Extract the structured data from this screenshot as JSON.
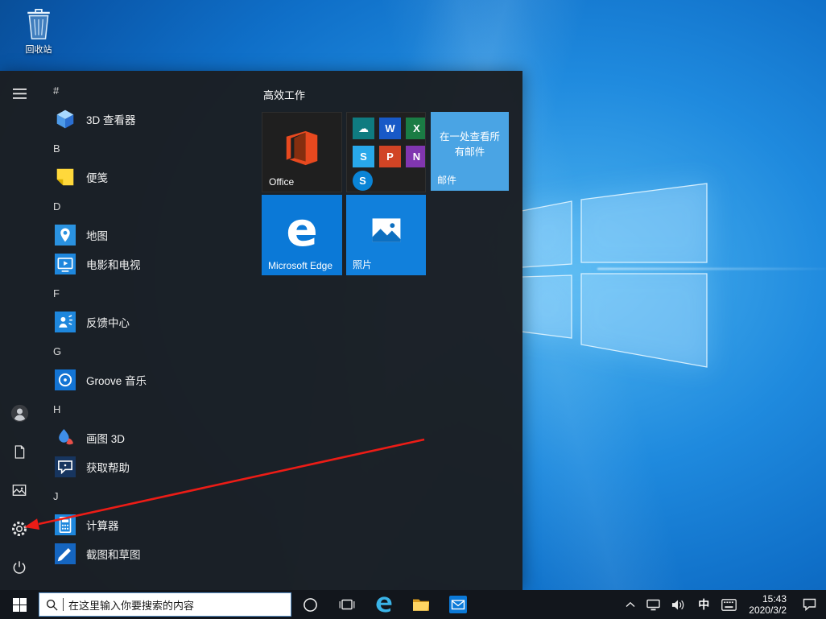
{
  "desktop": {
    "recycle_bin_label": "回收站"
  },
  "start_menu": {
    "rail": {
      "top": [
        {
          "id": "expand-menu",
          "icon": "hamburger"
        }
      ],
      "bottom": [
        {
          "id": "user-account",
          "icon": "user"
        },
        {
          "id": "documents",
          "icon": "document"
        },
        {
          "id": "pictures",
          "icon": "pictures"
        },
        {
          "id": "settings",
          "icon": "gear"
        },
        {
          "id": "power",
          "icon": "power"
        }
      ]
    },
    "app_list": [
      {
        "type": "header",
        "label": "#"
      },
      {
        "type": "app",
        "label": "3D 查看器",
        "icon": "viewer3d"
      },
      {
        "type": "header",
        "label": "B"
      },
      {
        "type": "app",
        "label": "便笺",
        "icon": "stickynotes"
      },
      {
        "type": "header",
        "label": "D"
      },
      {
        "type": "app",
        "label": "地图",
        "icon": "maps"
      },
      {
        "type": "app",
        "label": "电影和电视",
        "icon": "moviestv"
      },
      {
        "type": "header",
        "label": "F"
      },
      {
        "type": "app",
        "label": "反馈中心",
        "icon": "feedback"
      },
      {
        "type": "header",
        "label": "G"
      },
      {
        "type": "app",
        "label": "Groove 音乐",
        "icon": "groove"
      },
      {
        "type": "header",
        "label": "H"
      },
      {
        "type": "app",
        "label": "画图 3D",
        "icon": "paint3d"
      },
      {
        "type": "app",
        "label": "获取帮助",
        "icon": "gethelp"
      },
      {
        "type": "header",
        "label": "J"
      },
      {
        "type": "app",
        "label": "计算器",
        "icon": "calculator"
      },
      {
        "type": "app",
        "label": "截图和草图",
        "icon": "snip"
      }
    ],
    "tiles_header": "高效工作",
    "tiles": {
      "office": {
        "label": "Office"
      },
      "office365_promo": {
        "minis": [
          {
            "bg": "#0f7b80",
            "glyph": "☁"
          },
          {
            "bg": "#1859c7",
            "glyph": "W"
          },
          {
            "bg": "#1a7c44",
            "glyph": "X"
          },
          {
            "bg": "#28a8ea",
            "glyph": "S"
          },
          {
            "bg": "#d14425",
            "glyph": "P"
          },
          {
            "bg": "#8036b0",
            "glyph": "N"
          }
        ],
        "badge": {
          "bg": "#0a84d6",
          "glyph": "S"
        }
      },
      "mail": {
        "promo_text": "在一处查看所有邮件",
        "label": "邮件"
      },
      "edge": {
        "glyph": "e",
        "label": "Microsoft Edge"
      },
      "photos": {
        "label": "照片"
      }
    }
  },
  "taskbar": {
    "search_placeholder": "在这里输入你要搜索的内容",
    "buttons": [
      {
        "id": "cortana",
        "icon": "cortana"
      },
      {
        "id": "task-view",
        "icon": "taskview"
      },
      {
        "id": "edge",
        "icon": "edge"
      },
      {
        "id": "file-explorer",
        "icon": "explorer"
      },
      {
        "id": "mail",
        "icon": "mailapp"
      }
    ],
    "tray_buttons": [
      {
        "id": "tray-overflow",
        "icon": "chevronup"
      },
      {
        "id": "network",
        "icon": "network"
      },
      {
        "id": "volume",
        "icon": "speaker"
      }
    ],
    "tray": {
      "ime": "中",
      "time": "15:43",
      "date": "2020/3/2"
    }
  },
  "colors": {
    "accent": "#0078d7",
    "tile_blue": "#0b79d7",
    "mail_tile": "#4aa4e4",
    "taskbar": "#12161c",
    "start_bg": "#1b1e22",
    "arrow": "#ec1c16"
  }
}
